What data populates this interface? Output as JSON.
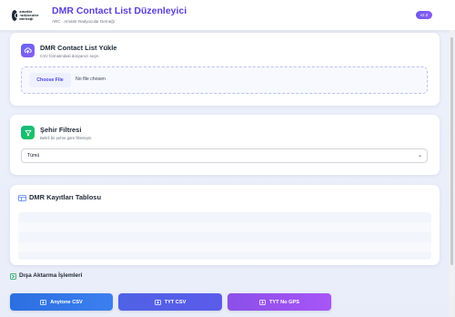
{
  "header": {
    "logo_text": "amatör radyocular derneği",
    "title": "DMR Contact List Düzenleyici",
    "subtitle": "ARC - Amatör Radyocular Derneği",
    "version": "v2.0"
  },
  "upload": {
    "title": "DMR Contact List Yükle",
    "description": "CSV formatındaki dosyanızı seçin",
    "choose_file_label": "Choose File",
    "file_status": "No file chosen"
  },
  "filter": {
    "title": "Şehir Filtresi",
    "description": "Belirli bir şehre göre filtreleyin",
    "selected_value": "Tümü"
  },
  "table": {
    "title": "DMR Kayıtları Tablosu"
  },
  "export": {
    "title": "Dışa Aktarma İşlemleri",
    "buttons": [
      {
        "label": "Anytone CSV"
      },
      {
        "label": "TYT CSV"
      },
      {
        "label": "TYT No GPS"
      }
    ]
  },
  "colors": {
    "accent": "#5b3fd6",
    "upload_icon": "#6366f1",
    "filter_icon": "#10b981",
    "anytone_button": "#2b6fe0",
    "tyt_button": "#4f62e6",
    "tyt_nogps_button": "#a855f7"
  },
  "icons": {
    "upload": "cloud-upload-icon",
    "filter": "funnel-icon",
    "table": "table-icon",
    "export": "export-icon",
    "download": "download-icon"
  }
}
